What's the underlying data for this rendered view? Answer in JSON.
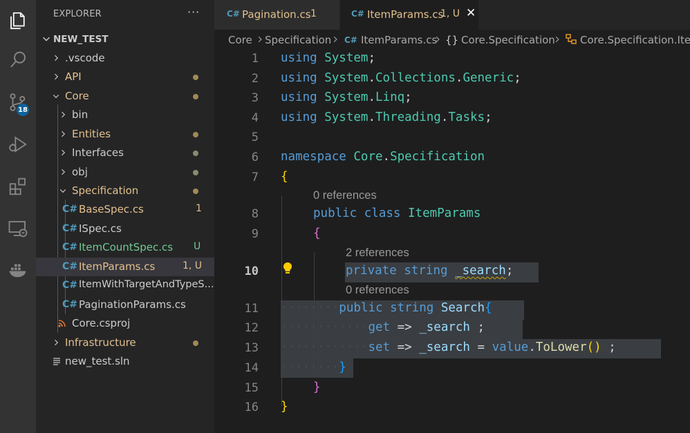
{
  "activity_bar": {
    "items": [
      "explorer-icon",
      "search-icon",
      "source-control-icon",
      "run-debug-icon",
      "extensions-icon",
      "remote-explorer-icon",
      "docker-icon"
    ],
    "source_control_badge": "18"
  },
  "sidebar": {
    "title": "EXPLORER",
    "more": "···",
    "section": "NEW_TEST",
    "tree": [
      {
        "label": ".vscode",
        "status": "",
        "color": "#cccccc"
      },
      {
        "label": "API",
        "status": "dot",
        "color": "#e2c08d"
      },
      {
        "label": "Core",
        "status": "dot",
        "color": "#e2c08d"
      },
      {
        "label": "bin",
        "status": "",
        "color": "#cccccc"
      },
      {
        "label": "Entities",
        "status": "dot",
        "color": "#e2c08d"
      },
      {
        "label": "Interfaces",
        "status": "dot",
        "color": "#cccccc"
      },
      {
        "label": "obj",
        "status": "dot",
        "color": "#cccccc"
      },
      {
        "label": "Specification",
        "status": "dot",
        "color": "#e2c08d"
      },
      {
        "label": "BaseSpec.cs",
        "status": "1",
        "color": "#e2c08d"
      },
      {
        "label": "ISpec.cs",
        "status": "",
        "color": "#cccccc"
      },
      {
        "label": "ItemCountSpec.cs",
        "status": "U",
        "color": "#73c991"
      },
      {
        "label": "ItemParams.cs",
        "status": "1, U",
        "color": "#e2c08d"
      },
      {
        "label": "ItemWithTargetAndTypeS...",
        "status": "",
        "color": "#cccccc"
      },
      {
        "label": "PaginationParams.cs",
        "status": "",
        "color": "#cccccc"
      },
      {
        "label": "Core.csproj",
        "status": "",
        "color": "#cccccc"
      },
      {
        "label": "Infrastructure",
        "status": "dot",
        "color": "#e2c08d"
      },
      {
        "label": "new_test.sln",
        "status": "",
        "color": "#cccccc"
      }
    ]
  },
  "tabs": [
    {
      "icon": "C#",
      "label": "Pagination.cs",
      "status": "1",
      "active": false
    },
    {
      "icon": "C#",
      "label": "ItemParams.cs",
      "status": "1, U",
      "active": true,
      "close": "✕"
    }
  ],
  "breadcrumb": [
    "Core",
    "Specification",
    "ItemParams.cs",
    "Core.Specification",
    "Core.Specification.ItemParams"
  ],
  "editor": {
    "line_numbers": [
      "1",
      "2",
      "3",
      "4",
      "5",
      "6",
      "7",
      "8",
      "9",
      "10",
      "11",
      "12",
      "13",
      "14",
      "15",
      "16"
    ],
    "active_line": "10",
    "codelens": [
      "0 references",
      "2 references",
      "0 references"
    ],
    "tokens": {
      "using": "using",
      "system": "System",
      "collections": "Collections",
      "generic": "Generic",
      "linq": "Linq",
      "threading": "Threading",
      "tasks": "Tasks",
      "namespace": "namespace",
      "core": "Core",
      "specification": "Specification",
      "public": "public",
      "class": "class",
      "itemparams": "ItemParams",
      "private": "private",
      "string": "string",
      "search_field": "_search",
      "search_prop": "Search",
      "get": "get",
      "set": "set",
      "arrow": "=>",
      "eq": "=",
      "value": "value",
      "tolower": "ToLower",
      "semi": ";",
      "dot": ".",
      "open_brace": "{",
      "close_brace": "}",
      "parens": "()"
    }
  }
}
